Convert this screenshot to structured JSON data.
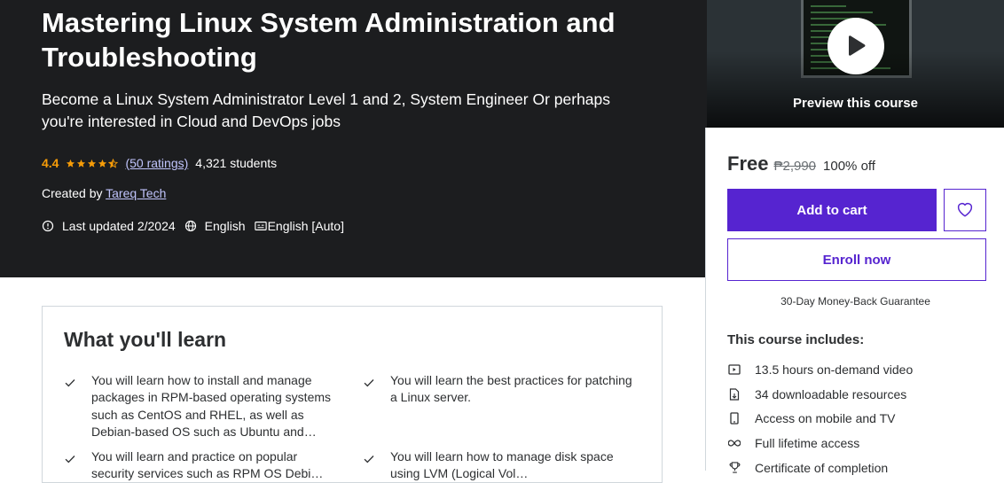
{
  "course": {
    "title": "Mastering Linux System Administration and Troubleshooting",
    "subtitle": "Become a Linux System Administrator Level 1 and 2, System Engineer Or perhaps you're interested in Cloud and DevOps jobs",
    "rating": "4.4",
    "rating_stars": 4.4,
    "ratings_count": "(50 ratings)",
    "students": "4,321 students",
    "created_by_label": "Created by",
    "instructor": "Tareq Tech",
    "last_updated": "Last updated 2/2024",
    "language": "English",
    "captions": "English [Auto]"
  },
  "preview": {
    "label": "Preview this course",
    "play_icon": "play-icon"
  },
  "pricing": {
    "current": "Free",
    "original": "₱2,990",
    "discount": "100% off",
    "add_to_cart": "Add to cart",
    "enroll": "Enroll now",
    "guarantee": "30-Day Money-Back Guarantee",
    "accent_color": "#5624d0"
  },
  "includes": {
    "title": "This course includes:",
    "items": [
      {
        "icon": "video-icon",
        "label": "13.5 hours on-demand video"
      },
      {
        "icon": "download-file-icon",
        "label": "34 downloadable resources"
      },
      {
        "icon": "mobile-tv-icon",
        "label": "Access on mobile and TV"
      },
      {
        "icon": "infinity-icon",
        "label": "Full lifetime access"
      },
      {
        "icon": "trophy-icon",
        "label": "Certificate of completion"
      }
    ]
  },
  "learn": {
    "title": "What you'll learn",
    "items": [
      "You will learn how to install and manage packages in RPM-based operating systems such as CentOS and RHEL, as well as Debian-based OS such as Ubuntu and…",
      "You will learn the best practices for patching a Linux server.",
      "You will learn and practice on popular security services such as RPM OS Debi…",
      "You will learn how to manage disk space using LVM (Logical Vol…"
    ]
  }
}
